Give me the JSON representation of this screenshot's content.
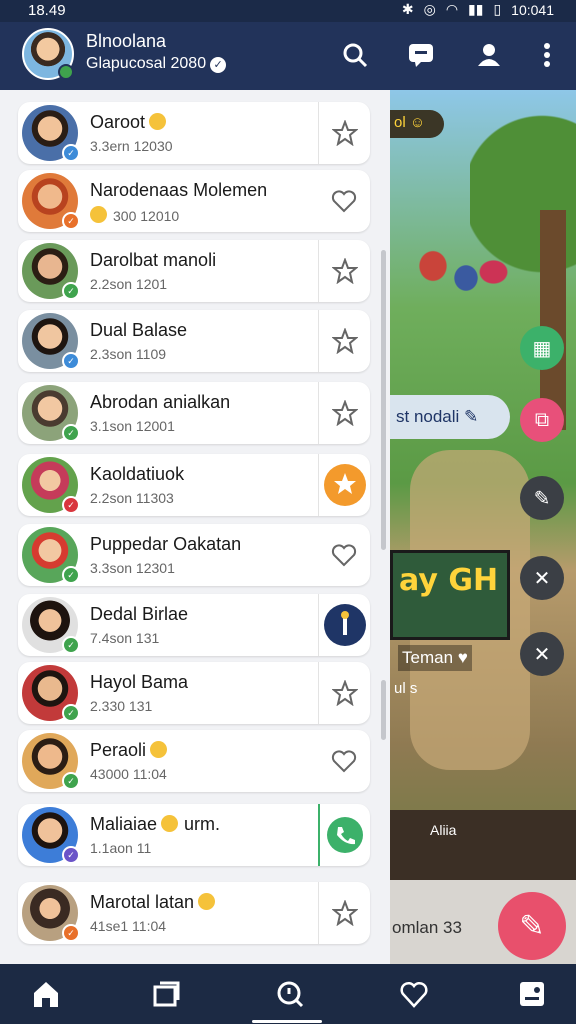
{
  "status_bar": {
    "time": "18.49",
    "right_time": "10:041"
  },
  "header": {
    "title": "Blnoolana",
    "subtitle": "Glapucosal 2080"
  },
  "contacts": [
    {
      "name": "Oaroot",
      "emoji": true,
      "sub": "3.3ern 12030",
      "action": "star-icon",
      "badge_color": "#3d8bd8"
    },
    {
      "name": "Narodenaas Molemen",
      "emoji": false,
      "sub": "300 12010",
      "sub_emoji": true,
      "action": "heart-icon",
      "badge_color": "#e8702a"
    },
    {
      "name": "Darolbat manoli",
      "emoji": false,
      "sub": "2.2son 1201",
      "action": "star-icon",
      "badge_color": "#3fa34d"
    },
    {
      "name": "Dual Balase",
      "emoji": false,
      "sub": "2.3son 1109",
      "action": "star-icon",
      "badge_color": "#3d8bd8"
    },
    {
      "name": "Abrodan anialkan",
      "emoji": false,
      "sub": "3.1son 12001",
      "action": "star-icon",
      "badge_color": "#3fa34d"
    },
    {
      "name": "Kaoldatiuok",
      "emoji": false,
      "sub": "2.2son 11303",
      "action": "star-badge-icon",
      "badge_color": "#d9363e"
    },
    {
      "name": "Puppedar Oakatan",
      "emoji": false,
      "sub": "3.3son 12301",
      "action": "heart-icon",
      "badge_color": "#3fa34d"
    },
    {
      "name": "Dedal Birlae",
      "emoji": false,
      "sub": "7.4son 131",
      "action": "media-icon",
      "badge_color": "#3fa34d"
    },
    {
      "name": "Hayol Bama",
      "emoji": false,
      "sub": "2.330 131",
      "action": "star-icon",
      "badge_color": "#3fa34d"
    },
    {
      "name": "Peraoli",
      "emoji": true,
      "sub": "43000 11:04",
      "action": "heart-icon",
      "badge_color": "#3fa34d"
    },
    {
      "name": "Maliaiae",
      "emoji": true,
      "name_suffix": "urm.",
      "sub": "1.1aon 11",
      "action": "phone-icon",
      "badge_color": "#6b54c8"
    },
    {
      "name": "Marotal latan",
      "emoji": true,
      "sub": "41se1 11:04",
      "action": "star-icon",
      "badge_color": "#e8702a"
    }
  ],
  "scene": {
    "top_pill": "ol",
    "mid_pill": "st nodali",
    "poster_text": "ay GH",
    "teman": "Teman",
    "small_text": "ul s",
    "aliah": "Aliia",
    "bottom_text": "omlan 33"
  },
  "colors": {
    "header_bg": "#22335a",
    "nav_bg": "#1c2a44",
    "fab": "#e8506c",
    "green_fab": "#3cb16a"
  },
  "bottom_nav": [
    "home-icon",
    "window-icon",
    "search-icon",
    "heart-icon",
    "profile-icon"
  ]
}
